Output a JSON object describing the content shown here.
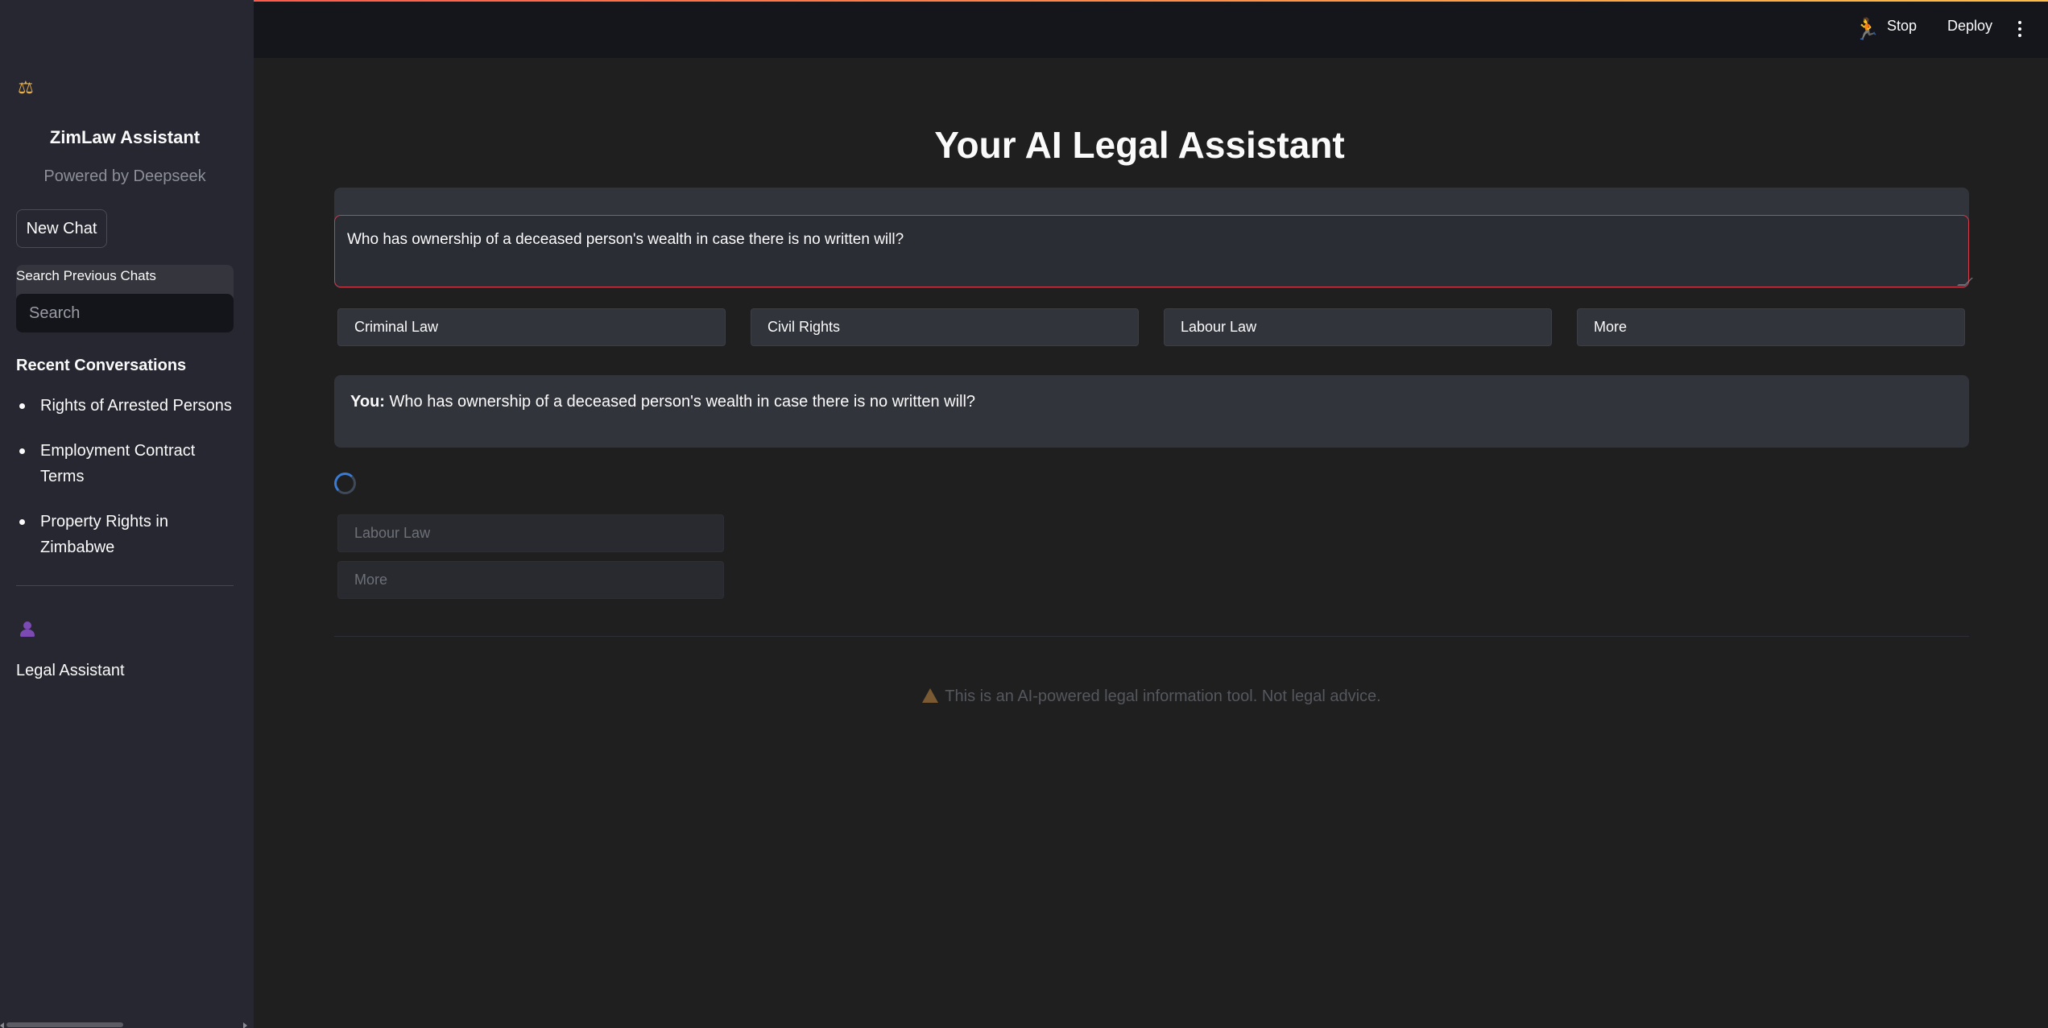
{
  "sidebar": {
    "logo_icon": "scales-icon",
    "app_title": "ZimLaw Assistant",
    "powered_by": "Powered by Deepseek",
    "new_chat_label": "New Chat",
    "search": {
      "label": "Search Previous Chats",
      "placeholder": "Search",
      "value": ""
    },
    "recent_heading": "Recent Conversations",
    "recent_items": [
      {
        "label": "Rights of Arrested Persons"
      },
      {
        "label": "Employment Contract Terms"
      },
      {
        "label": "Property Rights in Zimbabwe"
      }
    ],
    "user_icon": "user-icon",
    "user_label": "Legal Assistant"
  },
  "header": {
    "status_icon": "running-man-icon",
    "stop_label": "Stop",
    "deploy_label": "Deploy",
    "menu_icon": "kebab-menu-icon"
  },
  "main": {
    "title": "Your AI Legal Assistant",
    "question_value": "Who has ownership of a deceased person's wealth in case there is no written will?",
    "categories": [
      {
        "label": "Criminal Law"
      },
      {
        "label": "Civil Rights"
      },
      {
        "label": "Labour Law"
      },
      {
        "label": "More"
      }
    ],
    "chat": {
      "speaker": "You:",
      "message": "Who has ownership of a deceased person's wealth in case there is no written will?"
    },
    "faded_buttons": [
      {
        "label": "Labour Law"
      },
      {
        "label": "More"
      }
    ],
    "disclaimer": "This is an AI-powered legal information tool. Not legal advice."
  },
  "colors": {
    "accent_border": "#d63b4a",
    "sidebar_bg": "#262730",
    "main_bg": "#1f1f1f",
    "spinner": "#3a7bd5"
  }
}
